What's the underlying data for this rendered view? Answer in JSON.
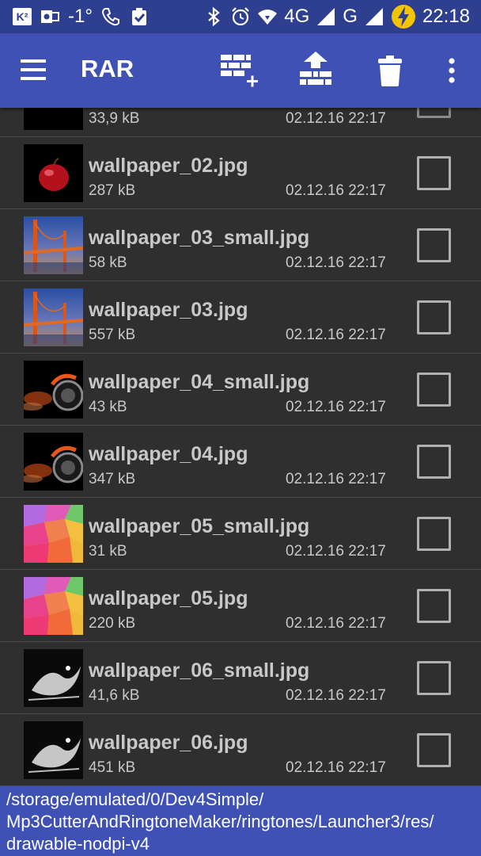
{
  "status_bar": {
    "carrier_badge": "K²",
    "temperature": "-1°",
    "network_4g": "4G",
    "network_g": "G",
    "time": "22:18"
  },
  "app_bar": {
    "title": "RAR",
    "actions": [
      "add-to-archive-icon",
      "extract-icon",
      "delete-icon",
      "more-vert-icon"
    ]
  },
  "partial_row": {
    "size": "33,9 kB",
    "date": "02.12.16 22:17"
  },
  "files": [
    {
      "name": "wallpaper_02.jpg",
      "size": "287 kB",
      "date": "02.12.16 22:17",
      "thumb": "apple"
    },
    {
      "name": "wallpaper_03_small.jpg",
      "size": "58 kB",
      "date": "02.12.16 22:17",
      "thumb": "bridge"
    },
    {
      "name": "wallpaper_03.jpg",
      "size": "557 kB",
      "date": "02.12.16 22:17",
      "thumb": "bridge"
    },
    {
      "name": "wallpaper_04_small.jpg",
      "size": "43 kB",
      "date": "02.12.16 22:17",
      "thumb": "wheel"
    },
    {
      "name": "wallpaper_04.jpg",
      "size": "347 kB",
      "date": "02.12.16 22:17",
      "thumb": "wheel"
    },
    {
      "name": "wallpaper_05_small.jpg",
      "size": "31 kB",
      "date": "02.12.16 22:17",
      "thumb": "polygons"
    },
    {
      "name": "wallpaper_05.jpg",
      "size": "220 kB",
      "date": "02.12.16 22:17",
      "thumb": "polygons"
    },
    {
      "name": "wallpaper_06_small.jpg",
      "size": "41,6 kB",
      "date": "02.12.16 22:17",
      "thumb": "splash"
    },
    {
      "name": "wallpaper_06.jpg",
      "size": "451 kB",
      "date": "02.12.16 22:17",
      "thumb": "splash"
    }
  ],
  "path": {
    "line1": "/storage/emulated/0/Dev4Simple/",
    "line2": "Mp3CutterAndRingtoneMaker/ringtones/Launcher3/res/",
    "line3": "drawable-nodpi-v4"
  },
  "colors": {
    "app_bar": "#3f51b5",
    "status_bar": "#2f3f8f",
    "list_bg": "#2f2f2f",
    "text": "#c8c8c8"
  }
}
